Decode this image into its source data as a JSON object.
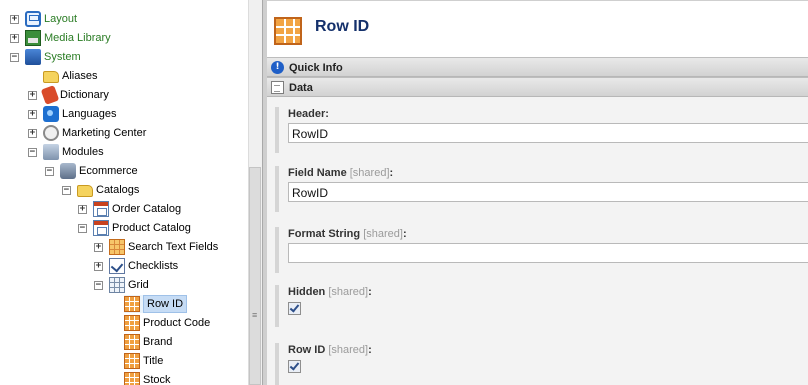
{
  "tree": {
    "nodes": [
      {
        "label": "Layout",
        "toggle": "+",
        "icon": "layout-icon"
      },
      {
        "label": "Media Library",
        "toggle": "+",
        "icon": "media-library-icon"
      },
      {
        "label": "System",
        "toggle": "−",
        "icon": "system-icon"
      },
      {
        "label": "Aliases",
        "toggle": "",
        "icon": "folder-icon"
      },
      {
        "label": "Dictionary",
        "toggle": "+",
        "icon": "dictionary-icon"
      },
      {
        "label": "Languages",
        "toggle": "+",
        "icon": "languages-icon"
      },
      {
        "label": "Marketing Center",
        "toggle": "+",
        "icon": "marketing-center-icon"
      },
      {
        "label": "Modules",
        "toggle": "−",
        "icon": "modules-icon"
      },
      {
        "label": "Ecommerce",
        "toggle": "−",
        "icon": "ecommerce-icon"
      },
      {
        "label": "Catalogs",
        "toggle": "−",
        "icon": "folder-icon"
      },
      {
        "label": "Order Catalog",
        "toggle": "+",
        "icon": "catalog-icon"
      },
      {
        "label": "Product Catalog",
        "toggle": "−",
        "icon": "catalog-icon"
      },
      {
        "label": "Search Text Fields",
        "toggle": "+",
        "icon": "fields-icon"
      },
      {
        "label": "Checklists",
        "toggle": "+",
        "icon": "checklist-icon"
      },
      {
        "label": "Grid",
        "toggle": "−",
        "icon": "grid-icon"
      },
      {
        "label": "Row ID",
        "toggle": "",
        "icon": "field-icon",
        "selected": true
      },
      {
        "label": "Product Code",
        "toggle": "",
        "icon": "field-icon"
      },
      {
        "label": "Brand",
        "toggle": "",
        "icon": "field-icon"
      },
      {
        "label": "Title",
        "toggle": "",
        "icon": "field-icon"
      },
      {
        "label": "Stock",
        "toggle": "",
        "icon": "field-icon"
      }
    ]
  },
  "splitter_grip": "≡",
  "editor": {
    "title": "Row ID",
    "quick_info_label": "Quick Info",
    "data_label": "Data",
    "info_glyph": "!",
    "fields": {
      "header": {
        "label": "Header",
        "value": "RowID"
      },
      "field_name": {
        "label": "Field Name",
        "shared": "[shared]",
        "value": "RowID"
      },
      "format_string": {
        "label": "Format String",
        "shared": "[shared]",
        "value": ""
      },
      "hidden": {
        "label": "Hidden",
        "shared": "[shared]",
        "checked": true
      },
      "row_id": {
        "label": "Row ID",
        "shared": "[shared]",
        "checked": true
      }
    },
    "colon": ":"
  },
  "colors": {
    "accent": "#14306b",
    "selection": "#c6dcf5",
    "tree_green": "#2a7c24"
  }
}
